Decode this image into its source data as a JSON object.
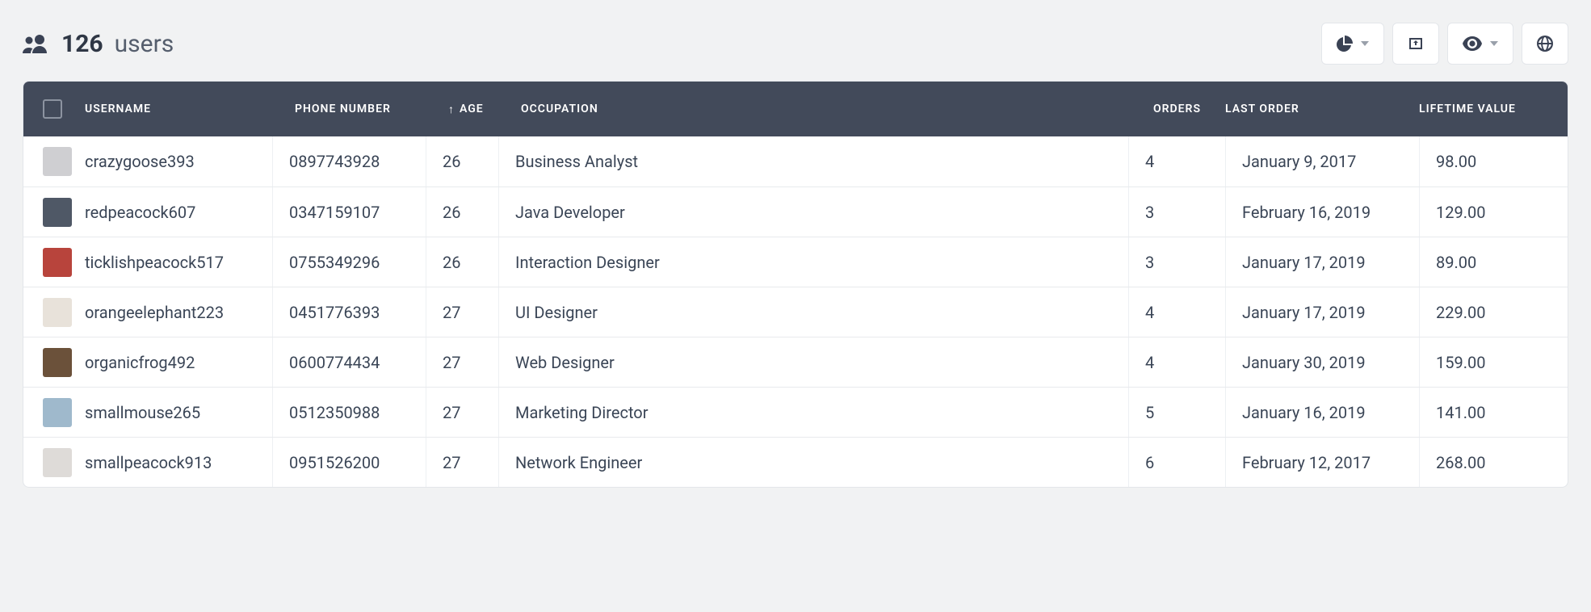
{
  "header": {
    "count": "126",
    "title_word": "users"
  },
  "columns": {
    "username": "USERNAME",
    "phone": "PHONE NUMBER",
    "age": "AGE",
    "sort_indicator": "↑",
    "occupation": "OCCUPATION",
    "orders": "ORDERS",
    "last_order": "LAST ORDER",
    "lifetime": "LIFETIME VALUE"
  },
  "rows": [
    {
      "avatar_color": "#cfcfd2",
      "username": "crazygoose393",
      "phone": "0897743928",
      "age": "26",
      "occupation": "Business Analyst",
      "orders": "4",
      "last_order": "January 9, 2017",
      "lifetime": "98.00"
    },
    {
      "avatar_color": "#4f5866",
      "username": "redpeacock607",
      "phone": "0347159107",
      "age": "26",
      "occupation": "Java Developer",
      "orders": "3",
      "last_order": "February 16, 2019",
      "lifetime": "129.00"
    },
    {
      "avatar_color": "#b8443c",
      "username": "ticklishpeacock517",
      "phone": "0755349296",
      "age": "26",
      "occupation": "Interaction Designer",
      "orders": "3",
      "last_order": "January 17, 2019",
      "lifetime": "89.00"
    },
    {
      "avatar_color": "#e8e2da",
      "username": "orangeelephant223",
      "phone": "0451776393",
      "age": "27",
      "occupation": "UI Designer",
      "orders": "4",
      "last_order": "January 17, 2019",
      "lifetime": "229.00"
    },
    {
      "avatar_color": "#6b513a",
      "username": "organicfrog492",
      "phone": "0600774434",
      "age": "27",
      "occupation": "Web Designer",
      "orders": "4",
      "last_order": "January 30, 2019",
      "lifetime": "159.00"
    },
    {
      "avatar_color": "#9fb9cc",
      "username": "smallmouse265",
      "phone": "0512350988",
      "age": "27",
      "occupation": "Marketing Director",
      "orders": "5",
      "last_order": "January 16, 2019",
      "lifetime": "141.00"
    },
    {
      "avatar_color": "#dedbd8",
      "username": "smallpeacock913",
      "phone": "0951526200",
      "age": "27",
      "occupation": "Network Engineer",
      "orders": "6",
      "last_order": "February 12, 2017",
      "lifetime": "268.00"
    }
  ]
}
